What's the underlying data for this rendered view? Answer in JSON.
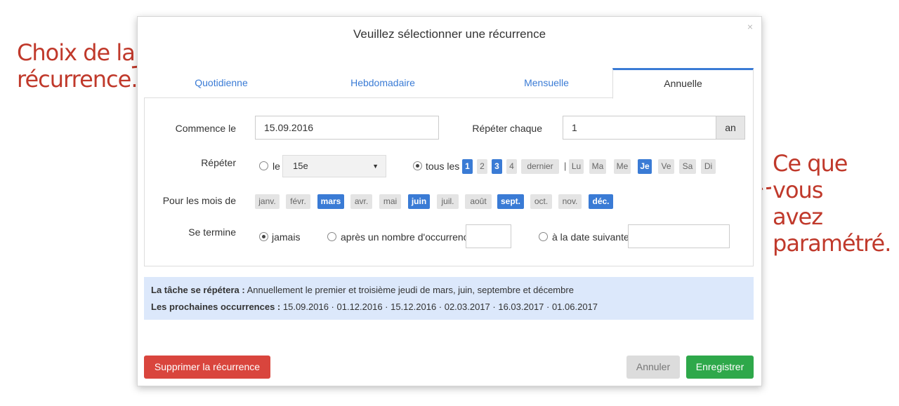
{
  "annotations": {
    "left_line1": "Choix de la",
    "left_line2": "récurrence.",
    "right_line1": "Ce que vous",
    "right_line2": "avez",
    "right_line3": "paramétré."
  },
  "modal": {
    "title": "Veuillez sélectionner une récurrence",
    "close": "×"
  },
  "tabs": [
    "Quotidienne",
    "Hebdomadaire",
    "Mensuelle",
    "Annuelle"
  ],
  "active_tab": "Annuelle",
  "form": {
    "start_label": "Commence le",
    "start_value": "15.09.2016",
    "repeat_every_label": "Répéter chaque",
    "repeat_every_value": "1",
    "repeat_every_unit": "an",
    "repeat_label": "Répéter",
    "le_label": "le",
    "le_select": "15e",
    "tous_les_label": "tous les",
    "ordinals": [
      {
        "label": "1",
        "selected": true
      },
      {
        "label": "2",
        "selected": false
      },
      {
        "label": "3",
        "selected": true
      },
      {
        "label": "4",
        "selected": false
      },
      {
        "label": "dernier",
        "selected": false
      }
    ],
    "separator": "|",
    "weekdays": [
      {
        "label": "Lu",
        "selected": false
      },
      {
        "label": "Ma",
        "selected": false
      },
      {
        "label": "Me",
        "selected": false
      },
      {
        "label": "Je",
        "selected": true
      },
      {
        "label": "Ve",
        "selected": false
      },
      {
        "label": "Sa",
        "selected": false
      },
      {
        "label": "Di",
        "selected": false
      }
    ],
    "months_label": "Pour les mois de",
    "months": [
      {
        "label": "janv.",
        "selected": false
      },
      {
        "label": "févr.",
        "selected": false
      },
      {
        "label": "mars",
        "selected": true
      },
      {
        "label": "avr.",
        "selected": false
      },
      {
        "label": "mai",
        "selected": false
      },
      {
        "label": "juin",
        "selected": true
      },
      {
        "label": "juil.",
        "selected": false
      },
      {
        "label": "août",
        "selected": false
      },
      {
        "label": "sept.",
        "selected": true
      },
      {
        "label": "oct.",
        "selected": false
      },
      {
        "label": "nov.",
        "selected": false
      },
      {
        "label": "déc.",
        "selected": true
      }
    ],
    "end_label": "Se termine",
    "end_never": "jamais",
    "end_after": "après un nombre d'occurrence",
    "end_date": "à la date suivante"
  },
  "summary": {
    "repeat_prefix": "La tâche se répétera :",
    "repeat_text": "Annuellement le premier et troisième jeudi de mars, juin, septembre et décembre",
    "next_prefix": "Les prochaines occurrences :",
    "next_text": "15.09.2016 · 01.12.2016 · 15.12.2016 · 02.03.2017 · 16.03.2017 · 01.06.2017"
  },
  "buttons": {
    "delete": "Supprimer la récurrence",
    "cancel": "Annuler",
    "save": "Enregistrer"
  },
  "colors": {
    "accent": "#3a7bd5",
    "danger": "#d9453d",
    "success": "#2ea84a",
    "annotation": "#c0392b",
    "summary_bg": "#dce8fb"
  }
}
